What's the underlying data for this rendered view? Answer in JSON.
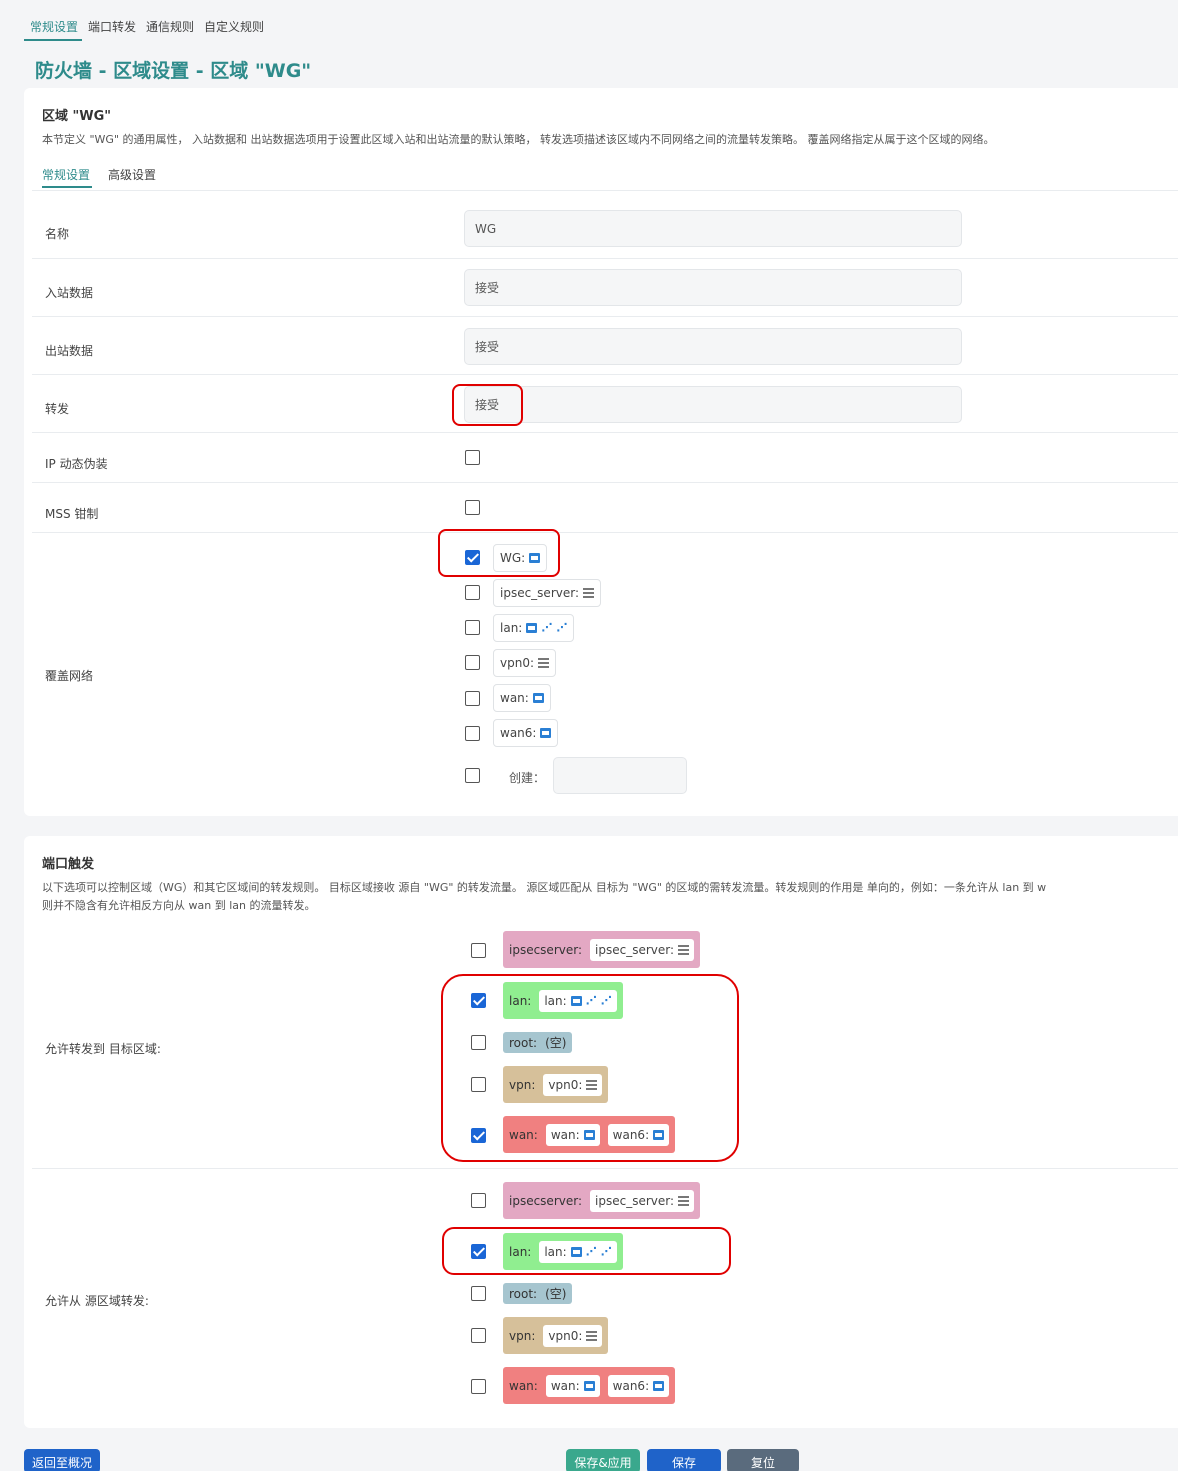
{
  "top_tabs": [
    "常规设置",
    "端口转发",
    "通信规则",
    "自定义规则"
  ],
  "page_title": "防火墙 - 区域设置 - 区域 \"WG\"",
  "zone_section": {
    "title": "区域 \"WG\"",
    "description": "本节定义 \"WG\" 的通用属性， 入站数据和 出站数据选项用于设置此区域入站和出站流量的默认策略， 转发选项描述该区域内不同网络之间的流量转发策略。 覆盖网络指定从属于这个区域的网络。",
    "subtabs": [
      "常规设置",
      "高级设置"
    ],
    "fields": {
      "name_label": "名称",
      "name_value": "WG",
      "input_label": "入站数据",
      "input_value": "接受",
      "output_label": "出站数据",
      "output_value": "接受",
      "forward_label": "转发",
      "forward_value": "接受",
      "masq_label": "IP 动态伪装",
      "mss_label": "MSS 钳制",
      "covered_label": "覆盖网络",
      "create_label": "创建："
    },
    "networks": [
      {
        "name": "WG:",
        "checked": true,
        "icons": [
          "ethernet-icon"
        ]
      },
      {
        "name": "ipsec_server:",
        "checked": false,
        "icons": [
          "server-icon"
        ]
      },
      {
        "name": "lan:",
        "checked": false,
        "icons": [
          "ethernet-icon",
          "wifi-icon",
          "wifi-icon"
        ]
      },
      {
        "name": "vpn0:",
        "checked": false,
        "icons": [
          "server-icon"
        ]
      },
      {
        "name": "wan:",
        "checked": false,
        "icons": [
          "ethernet-icon"
        ]
      },
      {
        "name": "wan6:",
        "checked": false,
        "icons": [
          "ethernet-icon"
        ]
      }
    ]
  },
  "forward_section": {
    "title": "端口触发",
    "desc_line1": "以下选项可以控制区域（WG）和其它区域间的转发规则。 目标区域接收 源自 \"WG\" 的转发流量。 源区域匹配从 目标为 \"WG\" 的区域的需转发流量。转发规则的作用是 单向的，例如：一条允许从 lan 到 w",
    "desc_line2": "则并不隐含有允许相反方向从 wan 到 lan 的流量转发。",
    "dest_label": "允许转发到 目标区域:",
    "src_label": "允许从 源区域转发:",
    "zone_names": {
      "ipsec": "ipsecserver:",
      "lan": "lan:",
      "root": "root:",
      "vpn": "vpn:",
      "wan": "wan:"
    },
    "zone_nets": {
      "ipsec": "ipsec_server:",
      "lan": "lan:",
      "root_empty": "(空)",
      "vpn": "vpn0:",
      "wan": "wan:",
      "wan6": "wan6:"
    },
    "dest_checked": {
      "ipsec": false,
      "lan": true,
      "root": false,
      "vpn": false,
      "wan": true
    },
    "src_checked": {
      "ipsec": false,
      "lan": true,
      "root": false,
      "vpn": false,
      "wan": false
    }
  },
  "buttons": {
    "back": "返回至概况",
    "save_apply": "保存&应用",
    "save": "保存",
    "reset": "复位"
  },
  "colors": {
    "accent": "#2e8b8b",
    "primary": "#1a66d6",
    "highlight": "#e00000"
  }
}
